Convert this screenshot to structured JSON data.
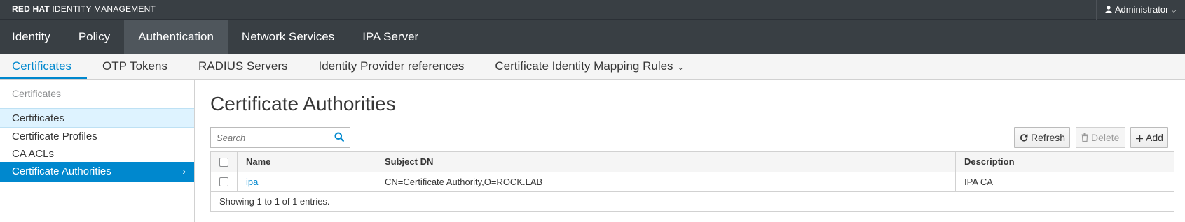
{
  "brand": {
    "bold": "RED HAT",
    "rest": "IDENTITY MANAGEMENT"
  },
  "user": {
    "label": "Administrator",
    "icon": "user-icon"
  },
  "primary_nav": [
    {
      "label": "Identity"
    },
    {
      "label": "Policy"
    },
    {
      "label": "Authentication",
      "active": true
    },
    {
      "label": "Network Services"
    },
    {
      "label": "IPA Server"
    }
  ],
  "secondary_nav": [
    {
      "label": "Certificates",
      "active": true
    },
    {
      "label": "OTP Tokens"
    },
    {
      "label": "RADIUS Servers"
    },
    {
      "label": "Identity Provider references"
    },
    {
      "label": "Certificate Identity Mapping Rules"
    }
  ],
  "sidebar": {
    "heading": "Certificates",
    "items": [
      {
        "label": "Certificates",
        "state": "hover"
      },
      {
        "label": "Certificate Profiles"
      },
      {
        "label": "CA ACLs"
      },
      {
        "label": "Certificate Authorities",
        "state": "active"
      }
    ]
  },
  "main": {
    "title": "Certificate Authorities",
    "search_placeholder": "Search",
    "buttons": {
      "refresh": "Refresh",
      "delete": "Delete",
      "add": "Add"
    },
    "table": {
      "columns": [
        "Name",
        "Subject DN",
        "Description"
      ],
      "rows": [
        {
          "name": "ipa",
          "subject_dn": "CN=Certificate Authority,O=ROCK.LAB",
          "description": "IPA CA"
        }
      ],
      "footer": "Showing 1 to 1 of 1 entries."
    }
  },
  "colors": {
    "accent": "#0088ce",
    "nav_bg": "#393f44",
    "nav_active": "#4f565c",
    "hover_bg": "#def3ff"
  }
}
